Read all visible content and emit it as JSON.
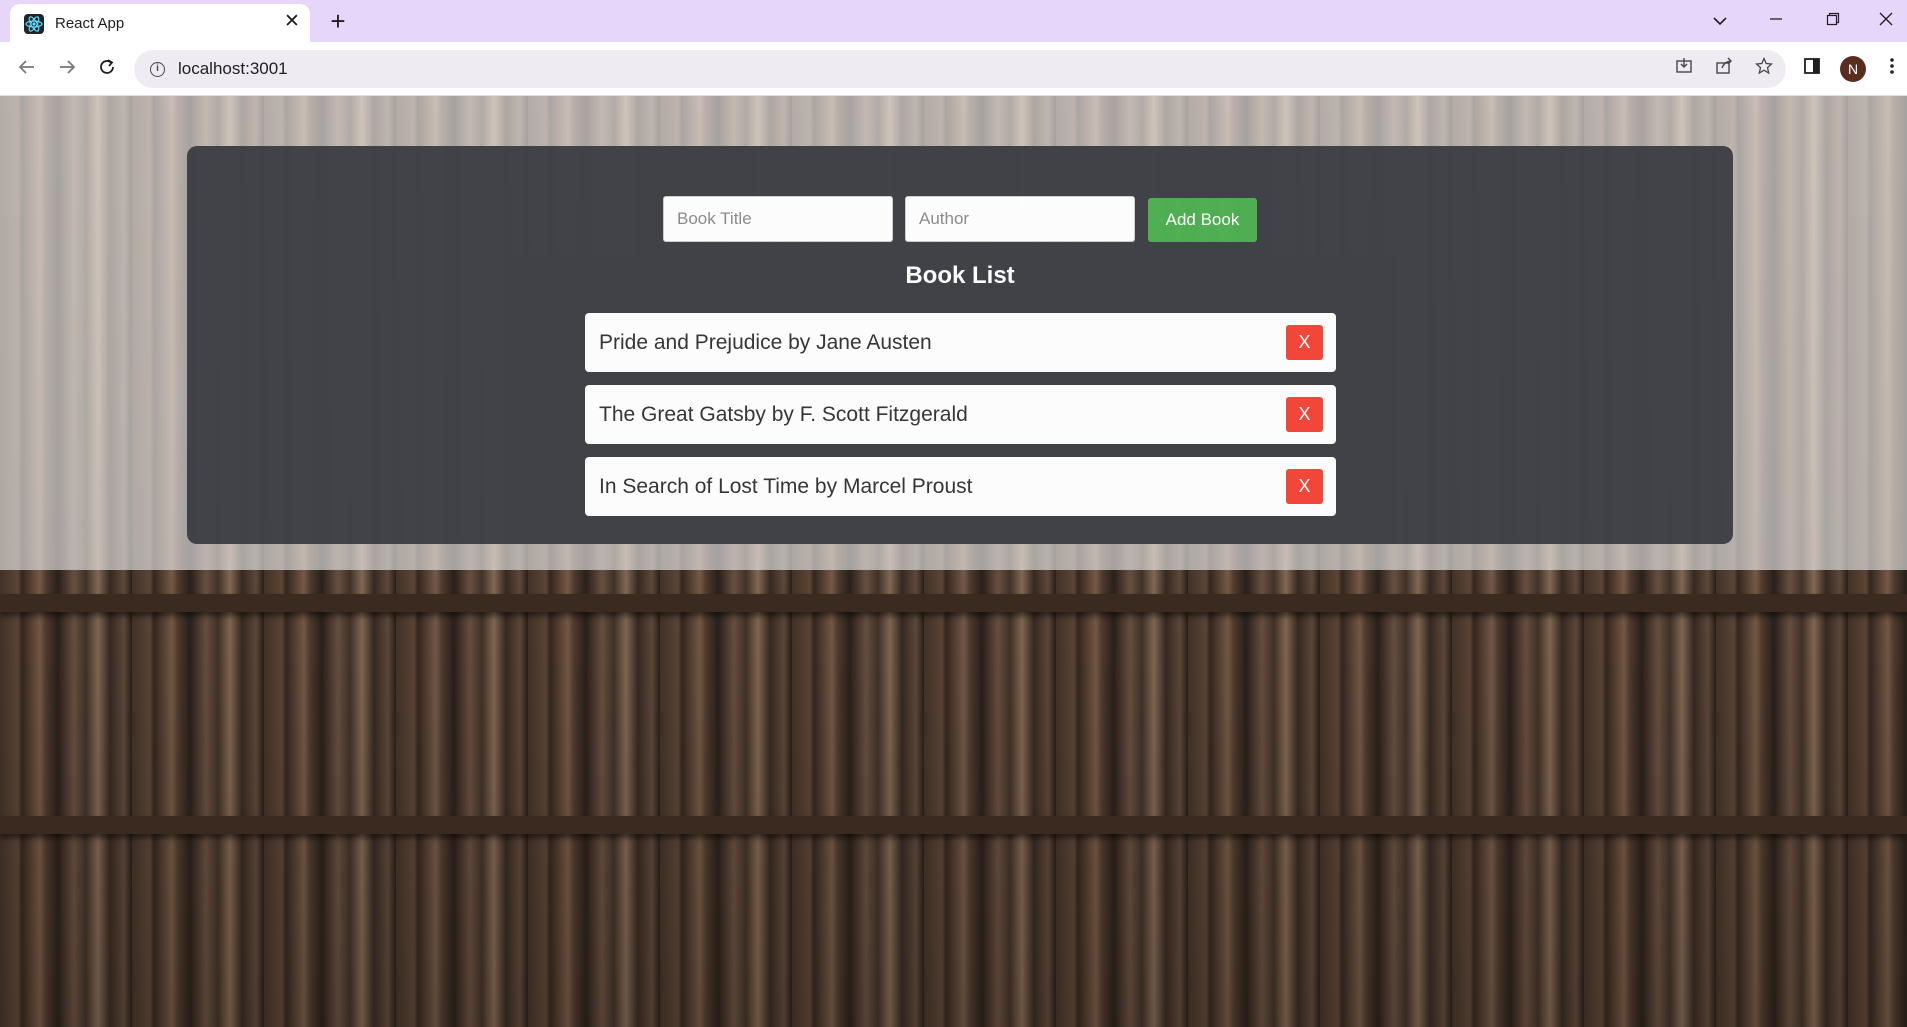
{
  "browser": {
    "tab_title": "React App",
    "tab_close": "✕",
    "new_tab": "+",
    "url": "localhost:3001",
    "profile_initial": "N",
    "icons": [
      "react-favicon-icon",
      "back-icon",
      "forward-icon",
      "reload-icon",
      "info-icon",
      "install-icon",
      "share-icon",
      "bookmark-star-icon",
      "side-panel-icon",
      "menu-dots-icon",
      "tab-search-icon",
      "minimize-icon",
      "restore-icon",
      "close-window-icon"
    ]
  },
  "form": {
    "title_placeholder": "Book Title",
    "author_placeholder": "Author",
    "title_value": "",
    "author_value": "",
    "add_label": "Add Book"
  },
  "list": {
    "heading": "Book List",
    "delete_label": "X",
    "items": [
      {
        "text": "Pride and Prejudice by Jane Austen"
      },
      {
        "text": "The Great Gatsby by F. Scott Fitzgerald"
      },
      {
        "text": "In Search of Lost Time by Marcel Proust"
      }
    ]
  },
  "colors": {
    "container_bg": "#3d3f45",
    "add_button": "#4caf50",
    "delete_button": "#f44336",
    "tabstrip": "#e6d7fa"
  }
}
